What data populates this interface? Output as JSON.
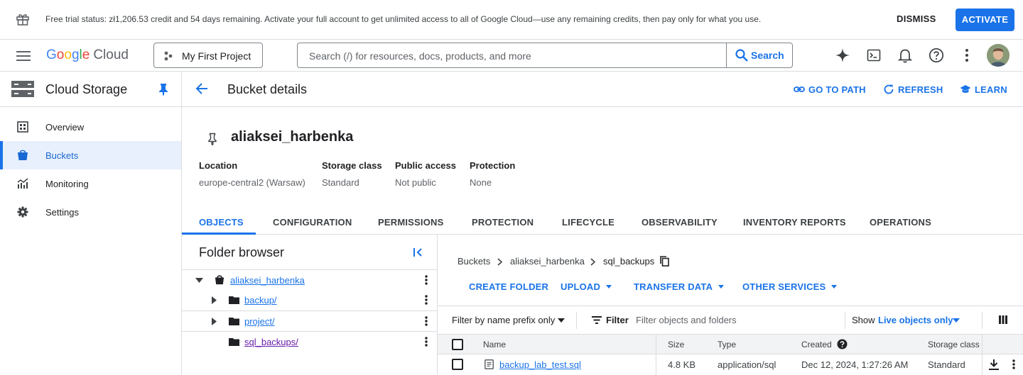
{
  "banner": {
    "message": "Free trial status: zł1,206.53 credit and 54 days remaining. Activate your full account to get unlimited access to all of Google Cloud—use any remaining credits, then pay only for what you use.",
    "dismiss": "DISMISS",
    "activate": "ACTIVATE"
  },
  "topbar": {
    "logo_letters": [
      "G",
      "o",
      "o",
      "g",
      "l",
      "e"
    ],
    "logo_cloud": "Cloud",
    "project": "My First Project",
    "search_placeholder": "Search (/) for resources, docs, products, and more",
    "search_button": "Search"
  },
  "leftnav": {
    "product": "Cloud Storage",
    "items": [
      {
        "label": "Overview",
        "icon": "overview-icon"
      },
      {
        "label": "Buckets",
        "icon": "bucket-icon",
        "active": true
      },
      {
        "label": "Monitoring",
        "icon": "monitoring-icon"
      },
      {
        "label": "Settings",
        "icon": "gear-icon"
      }
    ]
  },
  "page": {
    "title": "Bucket details",
    "actions": [
      "GO TO PATH",
      "REFRESH",
      "LEARN"
    ]
  },
  "bucket": {
    "name": "aliaksei_harbenka",
    "meta": [
      {
        "label": "Location",
        "value": "europe-central2 (Warsaw)"
      },
      {
        "label": "Storage class",
        "value": "Standard"
      },
      {
        "label": "Public access",
        "value": "Not public"
      },
      {
        "label": "Protection",
        "value": "None"
      }
    ]
  },
  "tabs": [
    "OBJECTS",
    "CONFIGURATION",
    "PERMISSIONS",
    "PROTECTION",
    "LIFECYCLE",
    "OBSERVABILITY",
    "INVENTORY REPORTS",
    "OPERATIONS"
  ],
  "folder_browser": {
    "title": "Folder browser",
    "root": "aliaksei_harbenka",
    "folders": [
      "backup/",
      "project/",
      "sql_backups/"
    ]
  },
  "breadcrumbs": [
    "Buckets",
    "aliaksei_harbenka",
    "sql_backups"
  ],
  "object_actions": [
    "CREATE FOLDER",
    "UPLOAD",
    "TRANSFER DATA",
    "OTHER SERVICES"
  ],
  "filter": {
    "mode": "Filter by name prefix only",
    "filter_label": "Filter",
    "placeholder": "Filter objects and folders",
    "show_label": "Show",
    "show_value": "Live objects only"
  },
  "table": {
    "headers": [
      "Name",
      "Size",
      "Type",
      "Created",
      "Storage class"
    ],
    "rows": [
      {
        "name": "backup_lab_test.sql",
        "size": "4.8 KB",
        "type": "application/sql",
        "created": "Dec 12, 2024, 1:27:26 AM",
        "storage_class": "Standard"
      }
    ]
  },
  "colors": {
    "accent": "#1a73e8",
    "visited": "#681da8",
    "active_bg": "#e8f0fe"
  }
}
